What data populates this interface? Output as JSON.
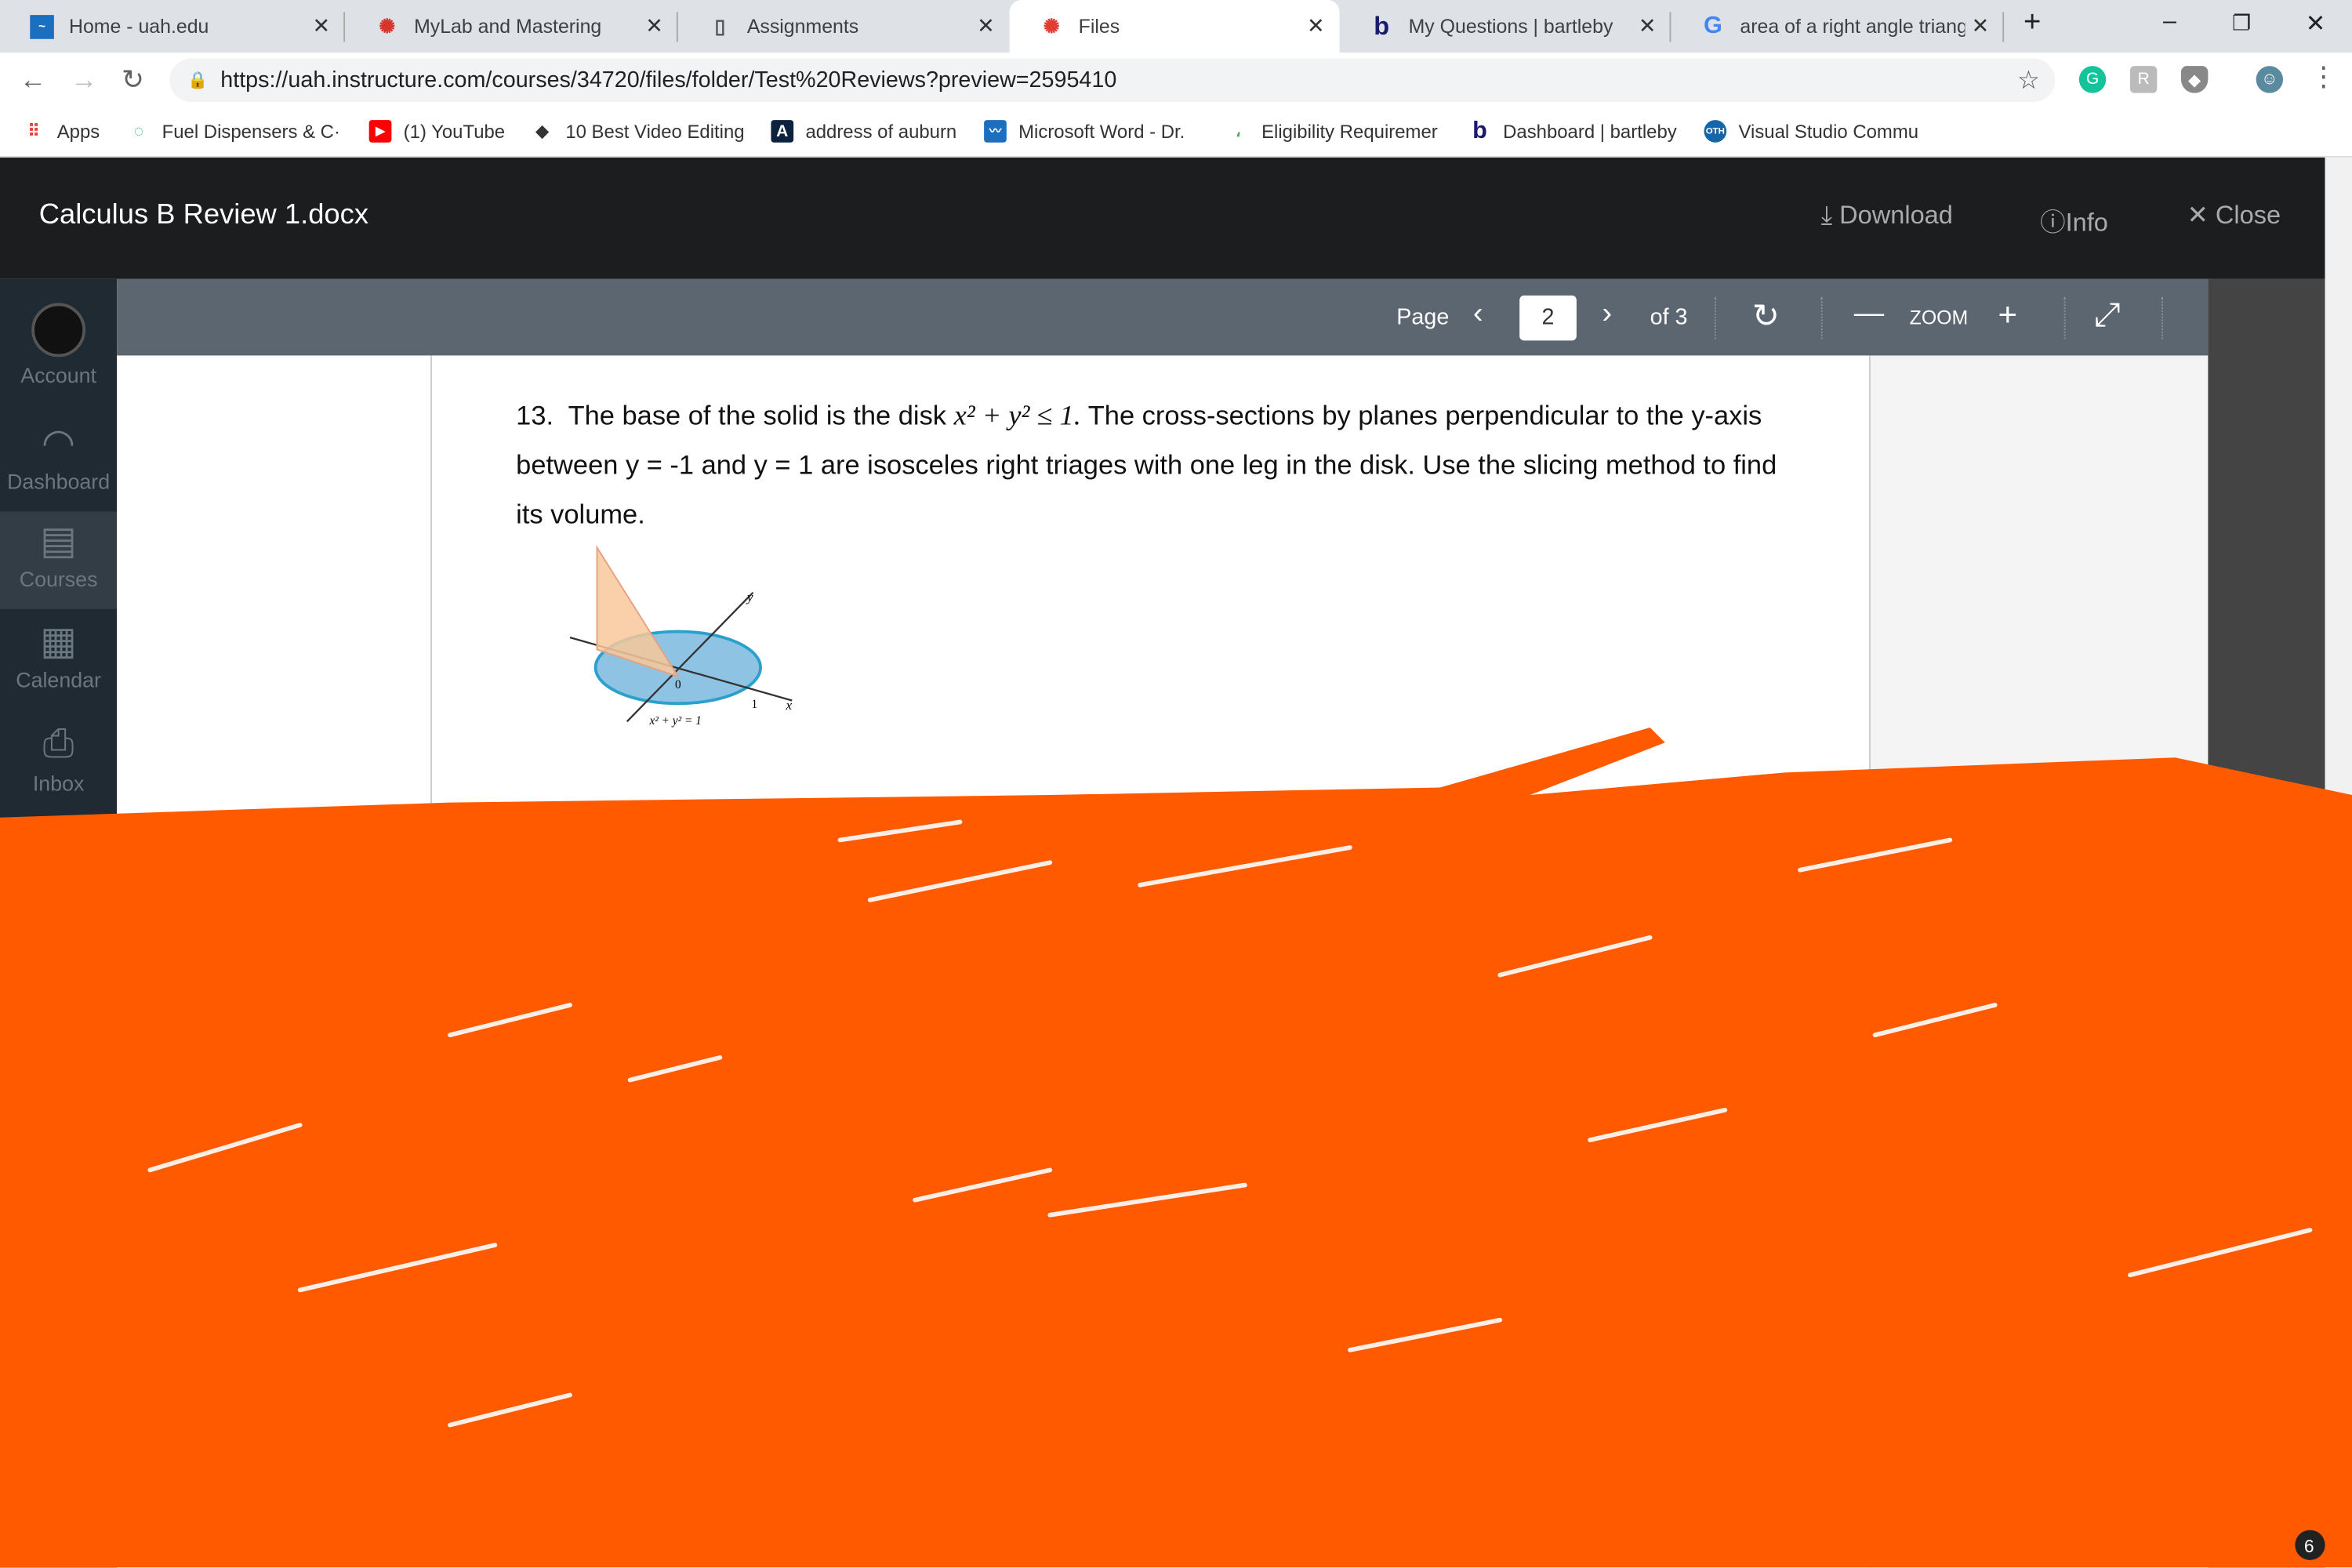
{
  "browser": {
    "tabs": [
      {
        "label": "Home - uah.edu",
        "icon": "uah-icon",
        "active": false
      },
      {
        "label": "MyLab and Mastering",
        "icon": "pearson-icon",
        "active": false
      },
      {
        "label": "Assignments",
        "icon": "document-icon",
        "active": false
      },
      {
        "label": "Files",
        "icon": "canvas-icon",
        "active": true
      },
      {
        "label": "My Questions | bartleby",
        "icon": "bartleby-icon",
        "active": false
      },
      {
        "label": "area of a right angle triangl",
        "icon": "google-icon",
        "active": false
      }
    ],
    "url": "https://uah.instructure.com/courses/34720/files/folder/Test%20Reviews?preview=2595410",
    "bookmarks": [
      {
        "label": "Apps",
        "icon": "apps-grid-icon"
      },
      {
        "label": "Fuel Dispensers & C·",
        "icon": "fuel-icon"
      },
      {
        "label": "(1) YouTube",
        "icon": "youtube-icon"
      },
      {
        "label": "10 Best Video Editing",
        "icon": "video-icon"
      },
      {
        "label": "address of auburn",
        "icon": "auburn-icon"
      },
      {
        "label": "Microsoft Word - Dr.",
        "icon": "word-icon"
      },
      {
        "label": "Eligibility Requiremer",
        "icon": "leaf-icon"
      },
      {
        "label": "Dashboard | bartleby",
        "icon": "bartleby-icon"
      },
      {
        "label": "Visual Studio Commu",
        "icon": "oth-icon"
      }
    ]
  },
  "sidebar": {
    "items": [
      {
        "label": "Account",
        "icon": "avatar-icon"
      },
      {
        "label": "Dashboard",
        "icon": "dashboard-icon"
      },
      {
        "label": "Courses",
        "icon": "book-icon"
      },
      {
        "label": "Calendar",
        "icon": "calendar-icon"
      },
      {
        "label": "Inbox",
        "icon": "inbox-icon"
      }
    ]
  },
  "viewer": {
    "title": "Calculus B Review 1.docx",
    "download": "Download",
    "info": "Info",
    "close": "Close",
    "page_label": "Page",
    "page_value": "2",
    "page_of": "of 3",
    "zoom_label": "ZOOM"
  },
  "document": {
    "q_number": "13.",
    "q_text_1": "The base of the solid is the disk",
    "q_math": "x² + y² ≤ 1.",
    "q_text_2": "The cross-sections by planes perpendicular to the y-axis between y = -1 and y = 1 are isosceles right triages with one leg in the disk.  Use the slicing method to find its volume.",
    "figure": {
      "label_y": "y",
      "label_x": "x",
      "label_origin": "0",
      "label_one": "1",
      "equation": "x² + y² = 1"
    }
  },
  "colors": {
    "scribble": "#ff5a00",
    "canvas_sidebar": "#1f2a32",
    "toolbar": "#5c6670"
  },
  "badge": "6"
}
